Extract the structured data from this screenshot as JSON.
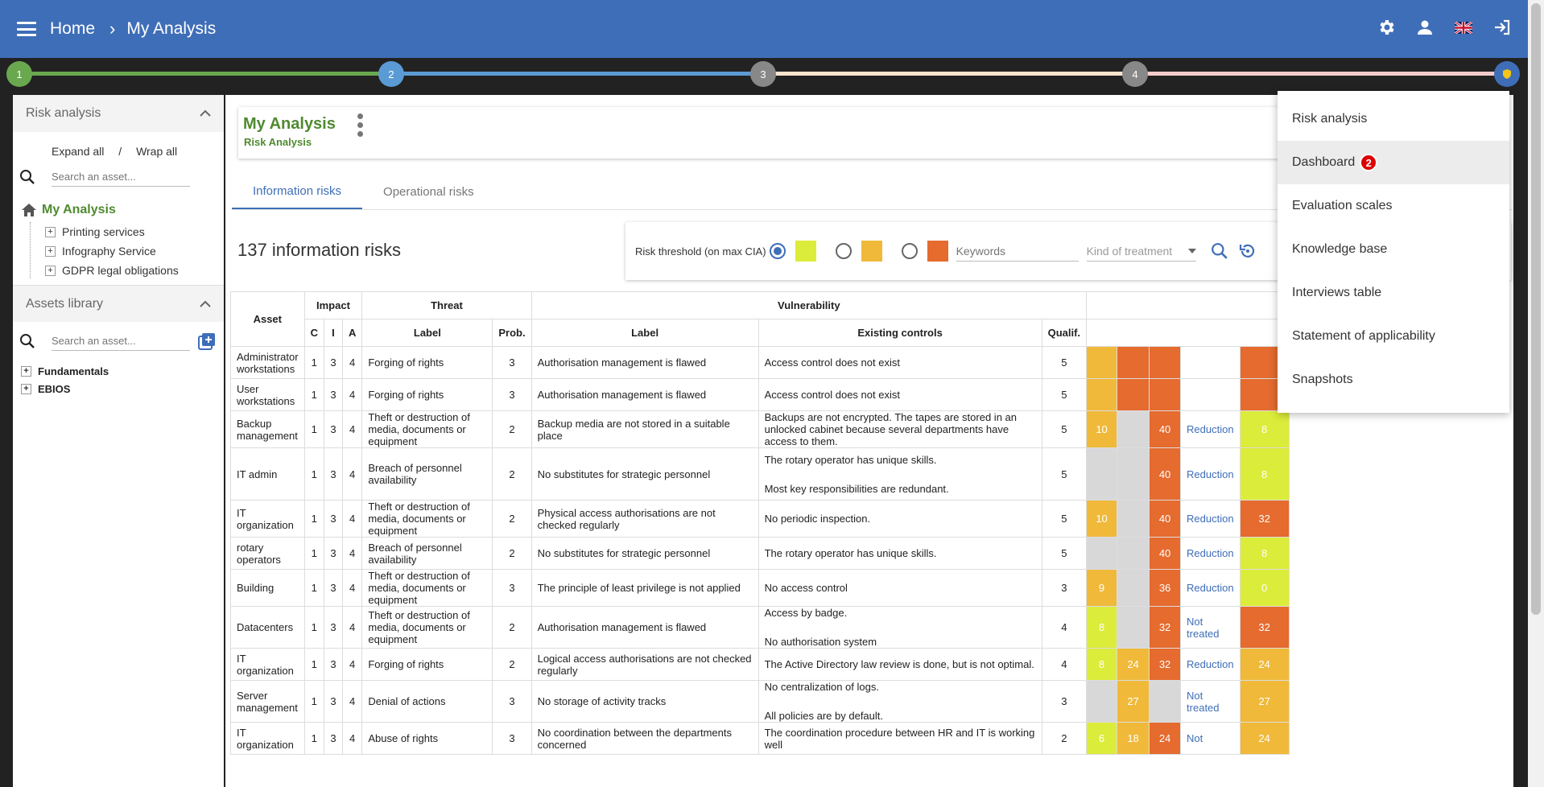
{
  "header": {
    "breadcrumb_home": "Home",
    "breadcrumb_current": "My Analysis",
    "icons": [
      "settings-icon",
      "user-icon",
      "uk-flag-icon",
      "logout-icon"
    ]
  },
  "stepper": {
    "steps": [
      "1",
      "2",
      "3",
      "4"
    ],
    "colors": [
      "#6aa84f",
      "#5b9bd5",
      "#fce5cd",
      "#f4cccc"
    ]
  },
  "sidebar": {
    "risk_section_title": "Risk analysis",
    "expand_all": "Expand all",
    "separator": "/",
    "wrap_all": "Wrap all",
    "search_placeholder": "Search an asset...",
    "root": "My Analysis",
    "items": [
      "Printing services",
      "Infography Service",
      "GDPR legal obligations"
    ],
    "assets_section_title": "Assets library",
    "assets_search_placeholder": "Search an asset...",
    "library_items": [
      "Fundamentals",
      "EBIOS"
    ]
  },
  "main": {
    "title": "My Analysis",
    "subtitle": "Risk Analysis",
    "tabs": [
      "Information risks",
      "Operational risks"
    ],
    "risk_count": "137 information risks",
    "filter": {
      "threshold_label": "Risk threshold (on max CIA)",
      "keywords_placeholder": "Keywords",
      "treatment_placeholder": "Kind of treatment",
      "swatch_colors": [
        "#dcec3a",
        "#f0b93a",
        "#e56b2f"
      ]
    }
  },
  "table": {
    "group_headers": [
      "Asset",
      "Impact",
      "Threat",
      "Vulnerability"
    ],
    "sub_headers": [
      "C",
      "I",
      "A",
      "Label",
      "Prob.",
      "Label",
      "Existing controls",
      "Qualif."
    ],
    "rows": [
      {
        "asset": "Administrator workstations",
        "c": "1",
        "i": "3",
        "a": "4",
        "threat": "Forging of rights",
        "prob": "3",
        "vuln": "Authorisation management is flawed",
        "controls": "Access control does not exist",
        "qualif": "5",
        "s1": "",
        "s2": "",
        "s3": "",
        "treatment": "",
        "res": ""
      },
      {
        "asset": "User workstations",
        "c": "1",
        "i": "3",
        "a": "4",
        "threat": "Forging of rights",
        "prob": "3",
        "vuln": "Authorisation management is flawed",
        "controls": "Access control does not exist",
        "qualif": "5",
        "s1": "",
        "s2": "",
        "s3": "",
        "treatment": "",
        "res": ""
      },
      {
        "asset": "Backup management",
        "c": "1",
        "i": "3",
        "a": "4",
        "threat": "Theft or destruction of media, documents or equipment",
        "prob": "2",
        "vuln": "Backup media are not stored in a suitable place",
        "controls": "Backups are not encrypted. The tapes are stored in an unlocked cabinet because several departments have access to them.",
        "qualif": "5",
        "s1": "10",
        "s2": "",
        "s3": "40",
        "treatment": "Reduction",
        "res": "8"
      },
      {
        "asset": "IT admin",
        "c": "1",
        "i": "3",
        "a": "4",
        "threat": "Breach of personnel availability",
        "prob": "2",
        "vuln": "No substitutes for strategic personnel",
        "controls": "The rotary operator has unique skills.",
        "controls2": "Most key responsibilities are redundant.",
        "qualif": "5",
        "s1": "",
        "s2": "",
        "s3": "40",
        "treatment": "Reduction",
        "res": "8"
      },
      {
        "asset": "IT organization",
        "c": "1",
        "i": "3",
        "a": "4",
        "threat": "Theft or destruction of media, documents or equipment",
        "prob": "2",
        "vuln": "Physical access authorisations are not checked regularly",
        "controls": "No periodic inspection.",
        "qualif": "5",
        "s1": "10",
        "s2": "",
        "s3": "40",
        "treatment": "Reduction",
        "res": "32"
      },
      {
        "asset": "rotary operators",
        "c": "1",
        "i": "3",
        "a": "4",
        "threat": "Breach of personnel availability",
        "prob": "2",
        "vuln": "No substitutes for strategic personnel",
        "controls": "The rotary operator has unique skills.",
        "qualif": "5",
        "s1": "",
        "s2": "",
        "s3": "40",
        "treatment": "Reduction",
        "res": "8"
      },
      {
        "asset": "Building",
        "c": "1",
        "i": "3",
        "a": "4",
        "threat": "Theft or destruction of media, documents or equipment",
        "prob": "3",
        "vuln": "The principle of least privilege is not applied",
        "controls": "No access control",
        "qualif": "3",
        "s1": "9",
        "s2": "",
        "s3": "36",
        "treatment": "Reduction",
        "res": "0"
      },
      {
        "asset": "Datacenters",
        "c": "1",
        "i": "3",
        "a": "4",
        "threat": "Theft or destruction of media, documents or equipment",
        "prob": "2",
        "vuln": "Authorisation management is flawed",
        "controls": "Access by badge.",
        "controls2": "No authorisation system",
        "qualif": "4",
        "s1": "8",
        "s2": "",
        "s3": "32",
        "treatment": "Not treated",
        "res": "32"
      },
      {
        "asset": "IT organization",
        "c": "1",
        "i": "3",
        "a": "4",
        "threat": "Forging of rights",
        "prob": "2",
        "vuln": "Logical access authorisations are not checked regularly",
        "controls": "The Active Directory law review is done, but is not optimal.",
        "qualif": "4",
        "s1": "8",
        "s2": "24",
        "s3": "32",
        "treatment": "Reduction",
        "res": "24"
      },
      {
        "asset": "Server management",
        "c": "1",
        "i": "3",
        "a": "4",
        "threat": "Denial of actions",
        "prob": "3",
        "vuln": "No storage of activity tracks",
        "controls": "No centralization of logs.",
        "controls2": "All policies are by default.",
        "qualif": "3",
        "s1": "",
        "s2": "27",
        "s3": "",
        "treatment": "Not treated",
        "res": "27"
      },
      {
        "asset": "IT organization",
        "c": "1",
        "i": "3",
        "a": "4",
        "threat": "Abuse of rights",
        "prob": "3",
        "vuln": "No coordination between the departments concerned",
        "controls": "The coordination procedure between HR and IT is working well",
        "qualif": "2",
        "s1": "6",
        "s2": "18",
        "s3": "24",
        "treatment": "Not",
        "res": "24"
      }
    ],
    "cell_colors": {
      "s1": [
        "#f0b93a",
        "#f0b93a",
        "#f0b93a",
        "#d8d8d8",
        "#f0b93a",
        "#d8d8d8",
        "#f0b93a",
        "#dcec3a",
        "#dcec3a",
        "#d8d8d8",
        "#dcec3a"
      ],
      "s2": [
        "#e56b2f",
        "#e56b2f",
        "#d8d8d8",
        "#d8d8d8",
        "#d8d8d8",
        "#d8d8d8",
        "#d8d8d8",
        "#d8d8d8",
        "#f0b93a",
        "#f0b93a",
        "#f0b93a"
      ],
      "s3": [
        "#e56b2f",
        "#e56b2f",
        "#e56b2f",
        "#e56b2f",
        "#e56b2f",
        "#e56b2f",
        "#e56b2f",
        "#e56b2f",
        "#e56b2f",
        "#d8d8d8",
        "#e56b2f"
      ],
      "res": [
        "#e56b2f",
        "#e56b2f",
        "#dcec3a",
        "#dcec3a",
        "#e56b2f",
        "#dcec3a",
        "#dcec3a",
        "#e56b2f",
        "#f0b93a",
        "#f0b93a",
        "#f0b93a"
      ]
    }
  },
  "dropdown": {
    "items": [
      "Risk analysis",
      "Dashboard",
      "Evaluation scales",
      "Knowledge base",
      "Interviews table",
      "Statement of applicability",
      "Snapshots"
    ],
    "badge": "2"
  }
}
